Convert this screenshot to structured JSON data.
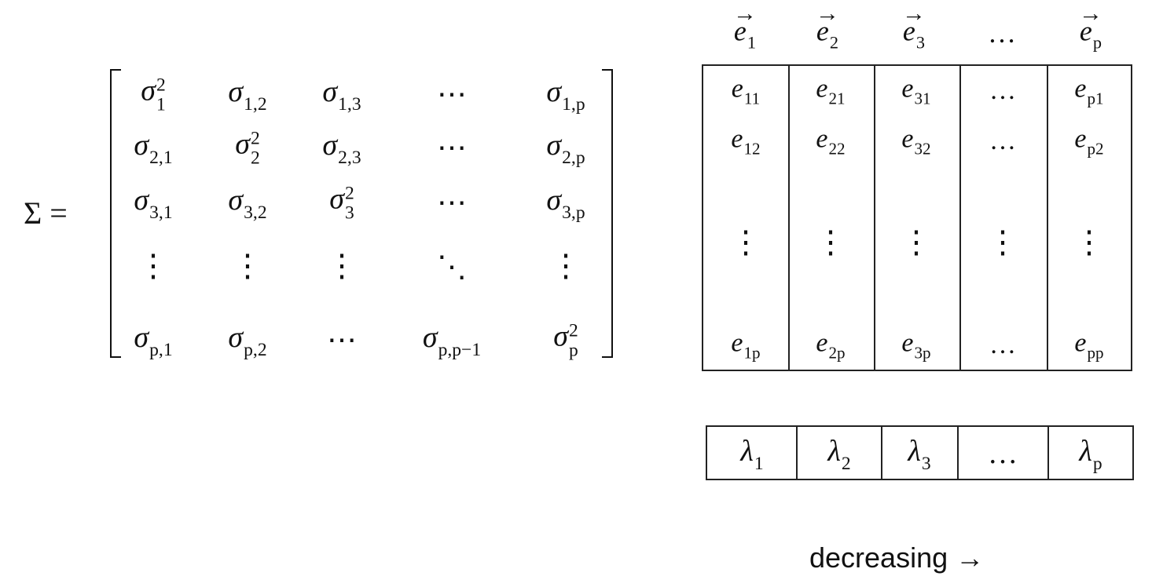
{
  "sigma": {
    "label": "Σ =",
    "rows": [
      [
        {
          "b": "σ",
          "sup": "2",
          "sub": "1"
        },
        {
          "b": "σ",
          "sub": "1,2"
        },
        {
          "b": "σ",
          "sub": "1,3"
        },
        {
          "b": "⋯"
        },
        {
          "b": "σ",
          "sub": "1,p"
        }
      ],
      [
        {
          "b": "σ",
          "sub": "2,1"
        },
        {
          "b": "σ",
          "sup": "2",
          "sub": "2"
        },
        {
          "b": "σ",
          "sub": "2,3"
        },
        {
          "b": "⋯"
        },
        {
          "b": "σ",
          "sub": "2,p"
        }
      ],
      [
        {
          "b": "σ",
          "sub": "3,1"
        },
        {
          "b": "σ",
          "sub": "3,2"
        },
        {
          "b": "σ",
          "sup": "2",
          "sub": "3"
        },
        {
          "b": "⋯"
        },
        {
          "b": "σ",
          "sub": "3,p"
        }
      ],
      [
        {
          "b": "⋮"
        },
        {
          "b": "⋮"
        },
        {
          "b": "⋮"
        },
        {
          "b": "⋱"
        },
        {
          "b": "⋮"
        }
      ],
      [
        {
          "b": "σ",
          "sub": "p,1"
        },
        {
          "b": "σ",
          "sub": "p,2"
        },
        {
          "b": "⋯"
        },
        {
          "b": "σ",
          "sub": "p,p−1"
        },
        {
          "b": "σ",
          "sup": "2",
          "sub": "p"
        }
      ]
    ]
  },
  "eigenvectors": {
    "headers": [
      {
        "b": "e",
        "sub": "1",
        "arrow": true
      },
      {
        "b": "e",
        "sub": "2",
        "arrow": true
      },
      {
        "b": "e",
        "sub": "3",
        "arrow": true
      },
      {
        "b": "…",
        "arrow": false
      },
      {
        "b": "e",
        "sub": "p",
        "arrow": true
      }
    ],
    "columns": [
      {
        "top": [
          {
            "b": "e",
            "sub": "11"
          },
          {
            "b": "e",
            "sub": "12"
          }
        ],
        "bottom": {
          "b": "e",
          "sub": "1p"
        }
      },
      {
        "top": [
          {
            "b": "e",
            "sub": "21"
          },
          {
            "b": "e",
            "sub": "22"
          }
        ],
        "bottom": {
          "b": "e",
          "sub": "2p"
        }
      },
      {
        "top": [
          {
            "b": "e",
            "sub": "31"
          },
          {
            "b": "e",
            "sub": "32"
          }
        ],
        "bottom": {
          "b": "e",
          "sub": "3p"
        }
      },
      {
        "top": [
          {
            "b": "…"
          },
          {
            "b": "…"
          }
        ],
        "bottom": {
          "b": "…"
        }
      },
      {
        "top": [
          {
            "b": "e",
            "sub": "p1"
          },
          {
            "b": "e",
            "sub": "p2"
          }
        ],
        "bottom": {
          "b": "e",
          "sub": "pp"
        }
      }
    ]
  },
  "eigenvalues": [
    {
      "b": "λ",
      "sub": "1"
    },
    {
      "b": "λ",
      "sub": "2"
    },
    {
      "b": "λ",
      "sub": "3"
    },
    {
      "b": "…"
    },
    {
      "b": "λ",
      "sub": "p"
    }
  ],
  "caption": "decreasing →"
}
